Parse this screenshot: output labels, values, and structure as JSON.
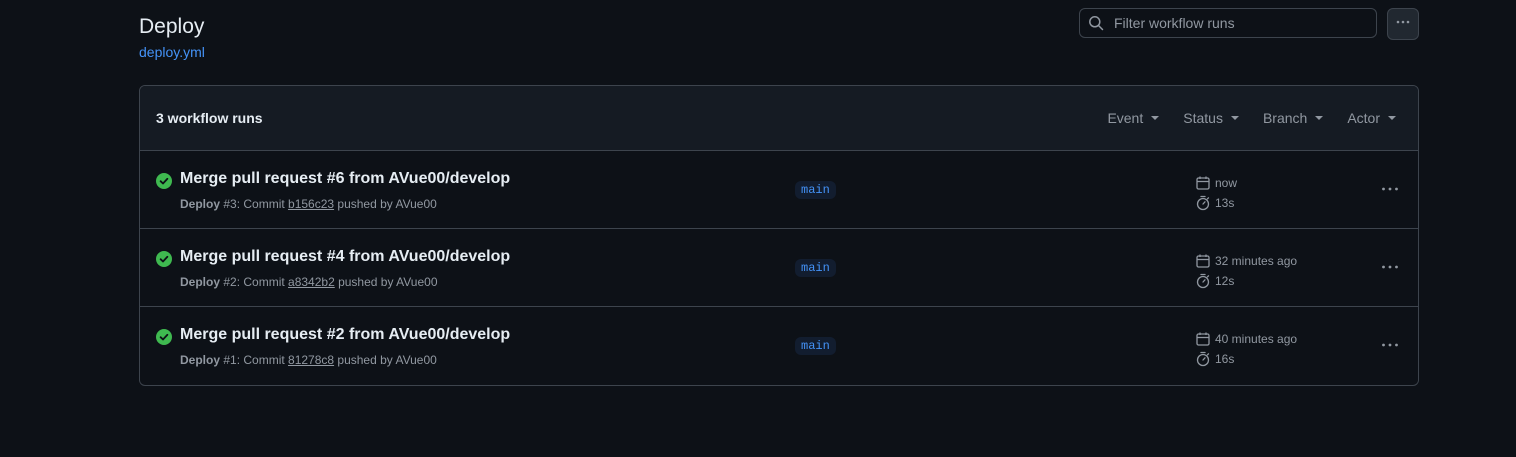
{
  "header": {
    "title": "Deploy",
    "workflow_file": "deploy.yml"
  },
  "search": {
    "placeholder": "Filter workflow runs"
  },
  "runs_box": {
    "count_label": "3 workflow runs",
    "filters": [
      "Event",
      "Status",
      "Branch",
      "Actor"
    ]
  },
  "runs": [
    {
      "title": "Merge pull request #6 from AVue00/develop",
      "workflow": "Deploy",
      "run_number": " #3: Commit ",
      "commit": "b156c23",
      "pushed_by": " pushed by AVue00",
      "branch": "main",
      "when": "now",
      "duration": "13s",
      "status": "success"
    },
    {
      "title": "Merge pull request #4 from AVue00/develop",
      "workflow": "Deploy",
      "run_number": " #2: Commit ",
      "commit": "a8342b2",
      "pushed_by": " pushed by AVue00",
      "branch": "main",
      "when": "32 minutes ago",
      "duration": "12s",
      "status": "success"
    },
    {
      "title": "Merge pull request #2 from AVue00/develop",
      "workflow": "Deploy",
      "run_number": " #1: Commit ",
      "commit": "81278c8",
      "pushed_by": " pushed by AVue00",
      "branch": "main",
      "when": "40 minutes ago",
      "duration": "16s",
      "status": "success"
    }
  ],
  "colors": {
    "background": "#0d1117",
    "header_bg": "#151b23",
    "border": "#3d444d",
    "link": "#4493f8",
    "success": "#3fb950",
    "muted": "#9198a1"
  },
  "icons": {
    "search": "search-icon",
    "more": "kebab-horizontal-icon",
    "status": "check-circle-fill-icon",
    "calendar": "calendar-icon",
    "stopwatch": "stopwatch-icon"
  }
}
